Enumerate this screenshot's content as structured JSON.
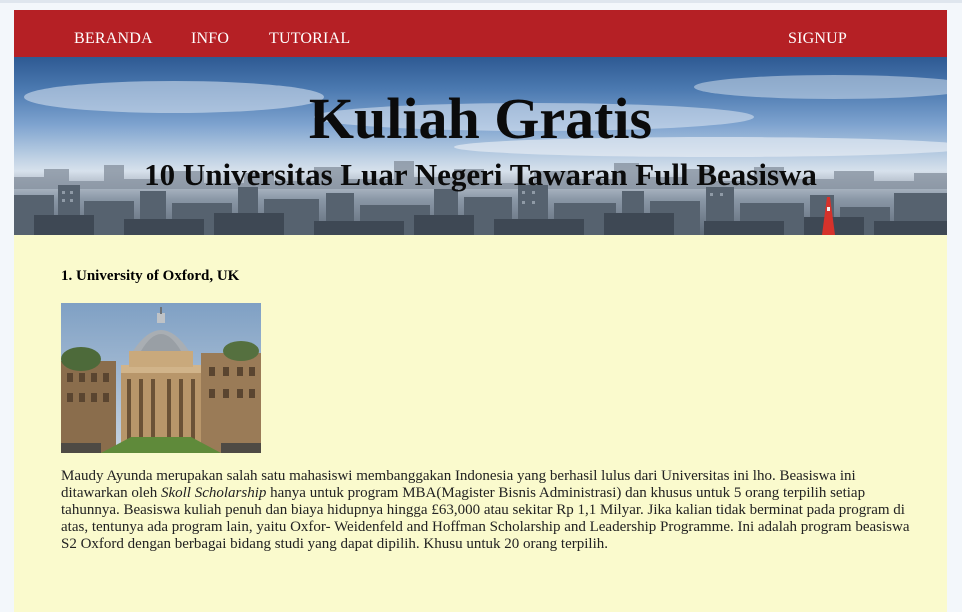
{
  "nav": {
    "beranda": "BERANDA",
    "info": "INFO",
    "tutorial": "TUTORIAL",
    "signup": "SIGNUP"
  },
  "hero": {
    "title": "Kuliah Gratis",
    "subtitle": "10 Universitas Luar Negeri Tawaran Full Beasiswa"
  },
  "article": {
    "heading": "1. University of Oxford, UK",
    "image_icon": "oxford-radcliffe-camera-photo",
    "body_part1": "Maudy Ayunda merupakan salah satu mahasiswi membanggakan Indonesia yang berhasil lulus dari Universitas ini lho. Beasiswa ini ditawarkan oleh ",
    "body_italic": "Skoll Scholarship",
    "body_part2": " hanya untuk program MBA(Magister Bisnis Administrasi) dan khusus untuk 5 orang terpilih setiap tahunnya. Beasiswa kuliah penuh dan biaya hidupnya hingga £63,000 atau sekitar Rp 1,1 Milyar. Jika kalian tidak berminat pada program di atas, tentunya ada program lain, yaitu Oxfor- Weidenfeld and Hoffman Scholarship and Leadership Programme. Ini adalah program beasiswa S2 Oxford dengan berbagai bidang studi yang dapat dipilih. Khusu untuk 20 orang terpilih."
  },
  "colors": {
    "navbar": "#b52025",
    "content_background": "#fafacd",
    "page_background": "#f3f7fb"
  }
}
